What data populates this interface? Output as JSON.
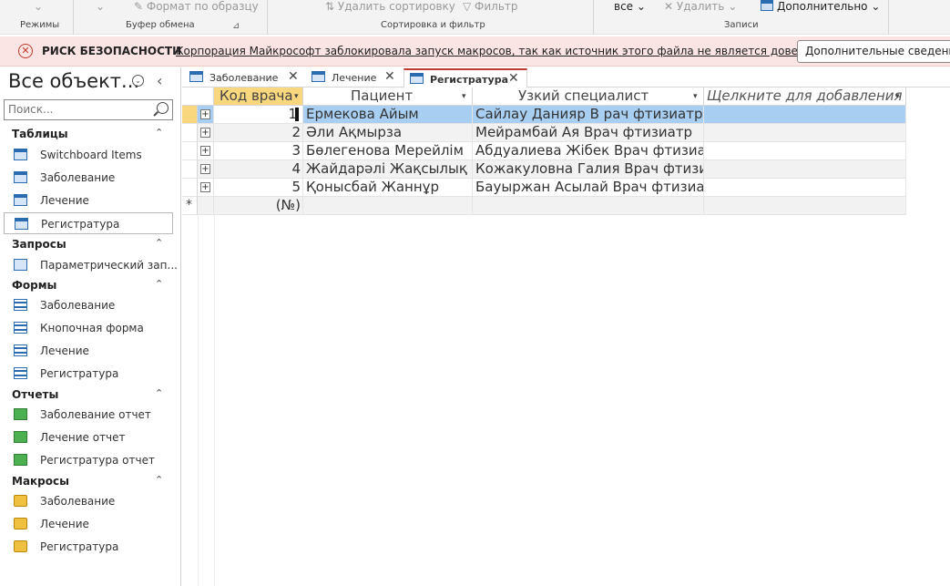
{
  "ribbon": {
    "format_painter": "Формат по образцу",
    "remove_sort": "Удалить сортировку",
    "filter": "Фильтр",
    "all": "все",
    "delete": "Удалить",
    "more": "Дополнительно",
    "group_views": "Режимы",
    "group_clipboard": "Буфер обмена",
    "group_sort_filter": "Сортировка и фильтр",
    "group_records": "Записи"
  },
  "security": {
    "title": "РИСК БЕЗОПАСНОСТИ",
    "message": "Корпорация Майкрософт заблокировала запуск макросов, так как источник этого файла не является доверенным.",
    "button": "Дополнительные сведения"
  },
  "nav": {
    "title": "Все объект...",
    "search_placeholder": "Поиск...",
    "sections": {
      "tables": "Таблицы",
      "queries": "Запросы",
      "forms": "Формы",
      "reports": "Отчеты",
      "macros": "Макросы"
    },
    "tables": [
      "Switchboard Items",
      "Заболевание",
      "Лечение",
      "Регистратура"
    ],
    "queries": [
      "Параметрический зап..."
    ],
    "forms": [
      "Заболевание",
      "Кнопочная форма",
      "Лечение",
      "Регистратура"
    ],
    "reports": [
      "Заболевание отчет",
      "Лечение отчет",
      "Регистратура отчет"
    ],
    "macros": [
      "Заболевание",
      "Лечение",
      "Регистратура"
    ]
  },
  "tabs": [
    "Заболевание",
    "Лечение",
    "Регистратура"
  ],
  "grid": {
    "columns": [
      "Код врача",
      "Пациент",
      "Узкий специалист",
      "Щелкните для добавления"
    ],
    "rows": [
      {
        "id": "1",
        "patient": "Ермекова Айым",
        "specialist": "Сайлау Данияр В рач фтизиатр"
      },
      {
        "id": "2",
        "patient": "Әли Ақмырза",
        "specialist": "Мейрамбай Ая Врач фтизиатр"
      },
      {
        "id": "3",
        "patient": "Бөлегенова Мерейлім",
        "specialist": "Абдуалиева Жібек Врач фтизиа"
      },
      {
        "id": "4",
        "patient": "Жайдарәлі Жақсылық",
        "specialist": "Кожакуловна Галия Врач фтизиат"
      },
      {
        "id": "5",
        "patient": "Қонысбай Жаннұр",
        "specialist": "Бауыржан Асылай Врач фтизиат"
      }
    ],
    "new_row_marker": "(№)"
  }
}
